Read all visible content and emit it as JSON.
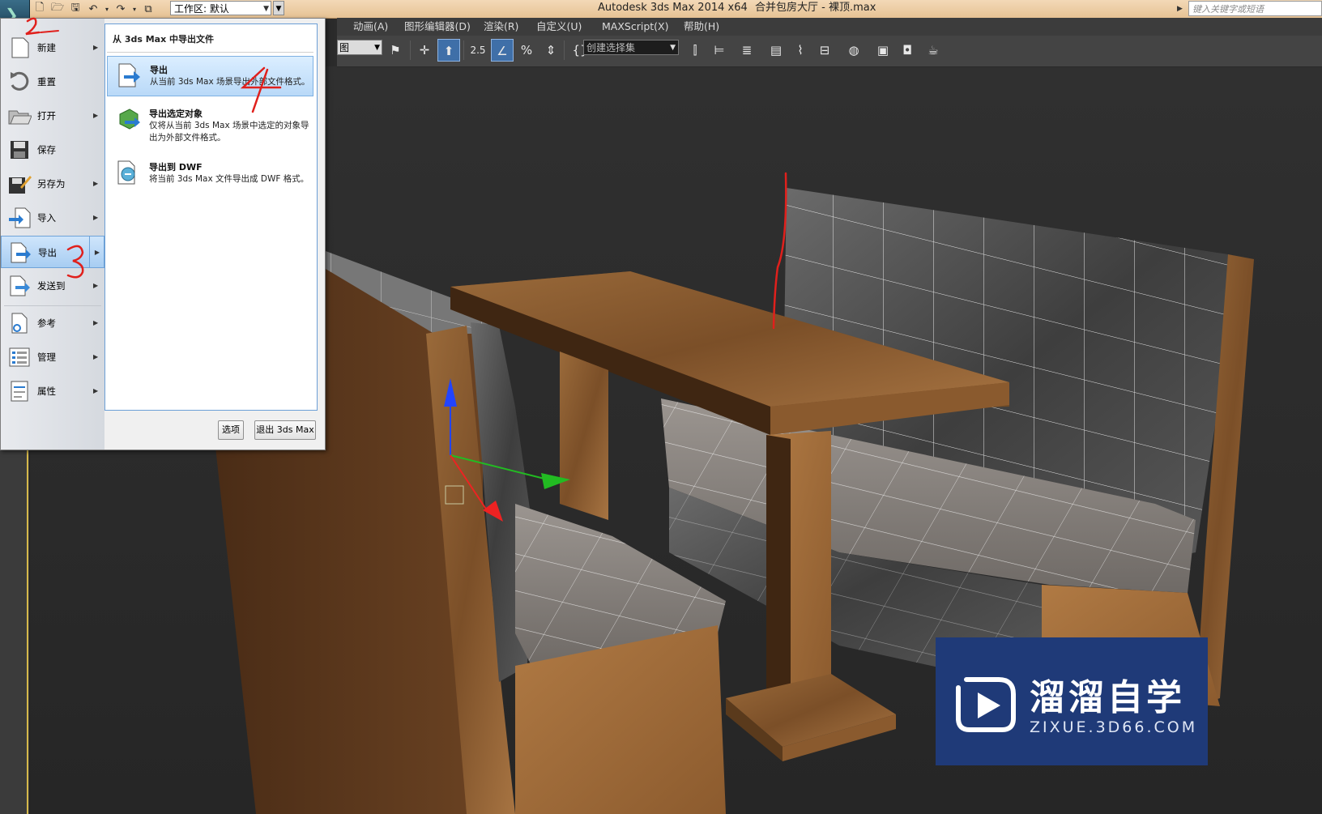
{
  "titlebar": {
    "workspace_label": "工作区: 默认",
    "title": "Autodesk 3ds Max  2014 x64",
    "file": "合并包房大厅 - 裸顶.max",
    "search_placeholder": "键入关键字或短语"
  },
  "menubar": {
    "items": [
      "动画(A)",
      "图形编辑器(D)",
      "渲染(R)",
      "自定义(U)",
      "MAXScript(X)",
      "帮助(H)"
    ]
  },
  "toolbar": {
    "view_combo": "图",
    "snap_label": "2.5",
    "selection_set": "创建选择集"
  },
  "appmenu": {
    "commands": [
      {
        "label": "新建",
        "icon": "new-file-icon",
        "submenu": true
      },
      {
        "label": "重置",
        "icon": "reset-icon",
        "submenu": false
      },
      {
        "label": "打开",
        "icon": "open-folder-icon",
        "submenu": true
      },
      {
        "label": "保存",
        "icon": "save-icon",
        "submenu": false
      },
      {
        "label": "另存为",
        "icon": "save-as-icon",
        "submenu": true
      },
      {
        "label": "导入",
        "icon": "import-icon",
        "submenu": true
      },
      {
        "label": "导出",
        "icon": "export-icon",
        "submenu": true,
        "active": true
      },
      {
        "label": "发送到",
        "icon": "send-to-icon",
        "submenu": true
      },
      {
        "label": "参考",
        "icon": "reference-icon",
        "submenu": true
      },
      {
        "label": "管理",
        "icon": "manage-icon",
        "submenu": true
      },
      {
        "label": "属性",
        "icon": "properties-icon",
        "submenu": true
      }
    ],
    "submenu_header": "从 3ds Max 中导出文件",
    "submenu_items": [
      {
        "title": "导出",
        "desc": "从当前 3ds Max 场景导出外部文件格式。",
        "icon": "export-icon"
      },
      {
        "title": "导出选定对象",
        "desc": "仅将从当前 3ds Max 场景中选定的对象导出为外部文件格式。",
        "icon": "export-selected-icon"
      },
      {
        "title": "导出到 DWF",
        "desc": "将当前 3ds Max 文件导出成 DWF 格式。",
        "icon": "export-dwf-icon"
      }
    ],
    "options_button": "选项",
    "exit_button": "退出 3ds Max"
  },
  "annotations": [
    "2",
    "3",
    "4"
  ],
  "watermark": {
    "title": "溜溜自学",
    "url": "ZIXUE.3D66.COM"
  },
  "colors": {
    "menu_highlight": "#a7cdf2",
    "viewport_bg": "#2b2b2b",
    "wood": "#8a5a2e",
    "annotation": "#e0201c",
    "watermark_bg": "#1f3a78"
  }
}
